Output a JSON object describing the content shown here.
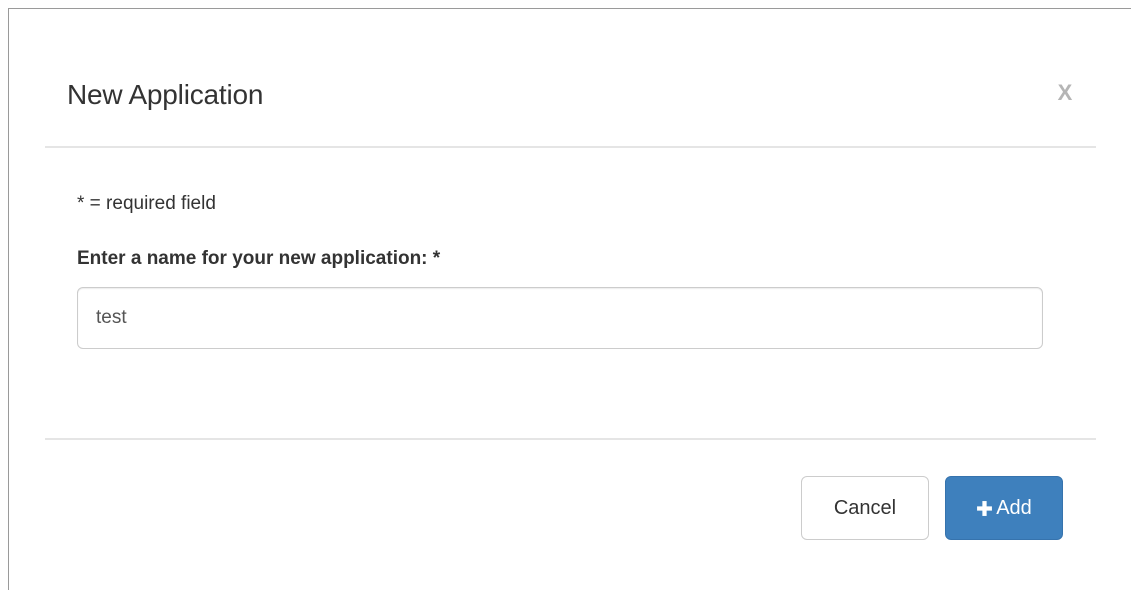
{
  "modal": {
    "title": "New Application",
    "close_label": "X"
  },
  "form": {
    "required_note": "* = required field",
    "name_label": "Enter a name for your new application: *",
    "name_value": "test"
  },
  "footer": {
    "cancel_label": "Cancel",
    "add_label": "Add",
    "add_icon": "plus-icon"
  },
  "colors": {
    "primary_button": "#3e80bd",
    "close_icon": "#b5b5b5",
    "divider": "#e5e5e5"
  }
}
